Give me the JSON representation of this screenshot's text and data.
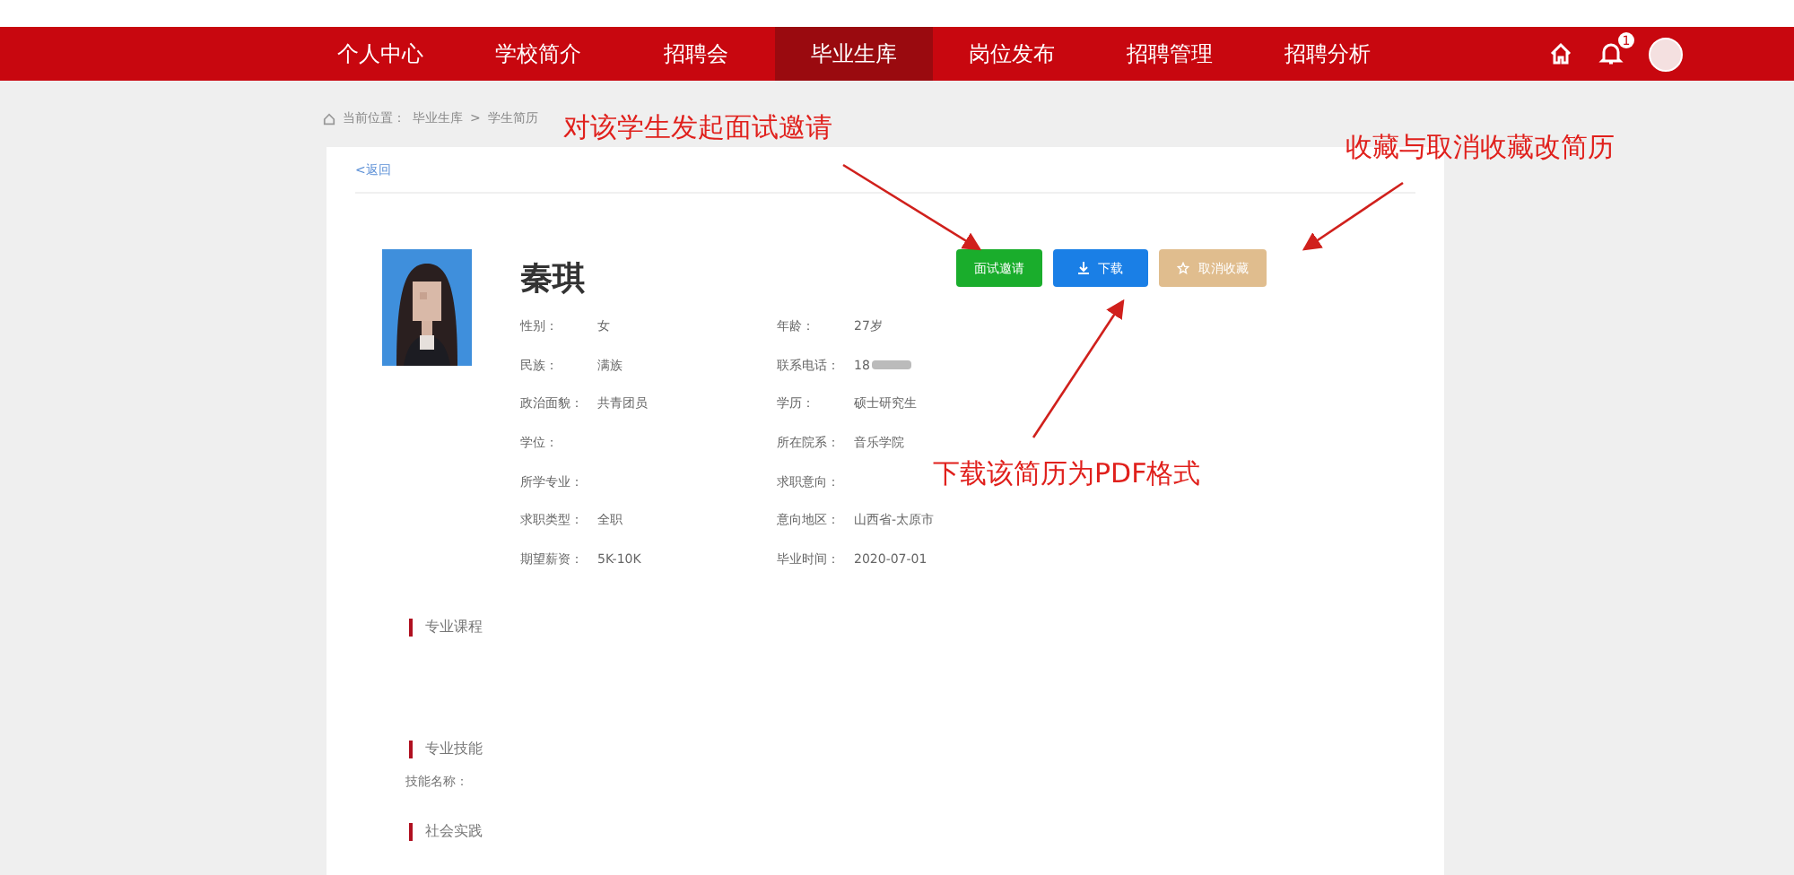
{
  "nav": {
    "items": [
      {
        "label": "个人中心",
        "selected": false
      },
      {
        "label": "学校简介",
        "selected": false
      },
      {
        "label": "招聘会",
        "selected": false
      },
      {
        "label": "毕业生库",
        "selected": true
      },
      {
        "label": "岗位发布",
        "selected": false
      },
      {
        "label": "招聘管理",
        "selected": false
      },
      {
        "label": "招聘分析",
        "selected": false
      }
    ],
    "notification_badge": "1"
  },
  "breadcrumb": {
    "label": "当前位置：",
    "path": [
      "毕业生库",
      "学生简历"
    ],
    "separator": ">"
  },
  "back_link": "<返回",
  "student": {
    "name": "秦琪",
    "fields": [
      {
        "label": "性别：",
        "value": "女"
      },
      {
        "label": "年龄：",
        "value": "27岁"
      },
      {
        "label": "民族：",
        "value": "满族"
      },
      {
        "label": "联系电话：",
        "value": "18",
        "masked": true
      },
      {
        "label": "政治面貌：",
        "value": "共青团员"
      },
      {
        "label": "学历：",
        "value": "硕士研究生"
      },
      {
        "label": "学位："
      },
      {
        "label": "所在院系：",
        "value": "音乐学院"
      },
      {
        "label": "所学专业："
      },
      {
        "label": "求职意向："
      },
      {
        "label": "求职类型：",
        "value": "全职"
      },
      {
        "label": "意向地区：",
        "value": "山西省-太原市"
      },
      {
        "label": "期望薪资：",
        "value": "5K-10K"
      },
      {
        "label": "毕业时间：",
        "value": "2020-07-01"
      }
    ]
  },
  "actions": [
    {
      "kind": "invite",
      "label": "面试邀请"
    },
    {
      "kind": "download",
      "label": "下载"
    },
    {
      "kind": "favorite",
      "label": "取消收藏"
    }
  ],
  "sections": [
    {
      "title": "专业课程"
    },
    {
      "title": "专业技能",
      "lines": [
        "技能名称："
      ]
    },
    {
      "title": "社会实践"
    }
  ],
  "annotations": [
    {
      "kind": "invite",
      "text": "对该学生发起面试邀请"
    },
    {
      "kind": "favorite",
      "text": "收藏与取消收藏改简历"
    },
    {
      "kind": "download",
      "text": "下载该简历为PDF格式"
    }
  ]
}
